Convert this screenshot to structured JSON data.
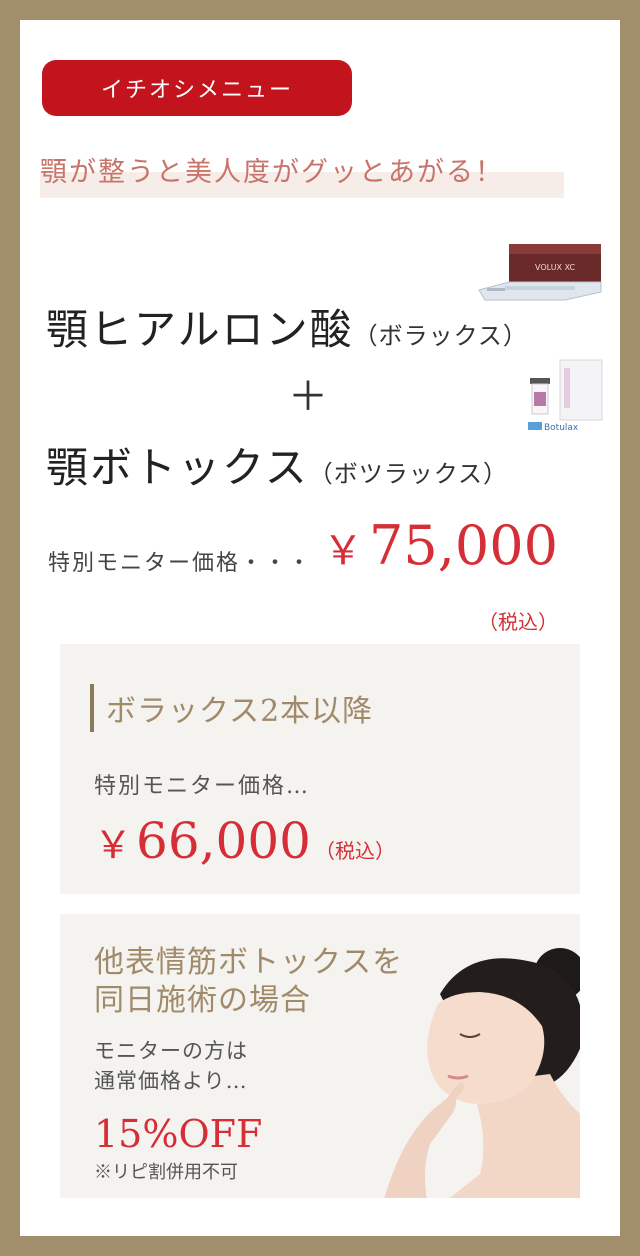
{
  "badge": "イチオシメニュー",
  "tagline": "顎が整うと美人度がグッとあがる！",
  "product1": {
    "name": "顎ヒアルロン酸",
    "note": "（ボラックス）"
  },
  "plus": "＋",
  "product2": {
    "name": "顎ボトックス",
    "note": "（ボツラックス）"
  },
  "monitor_label": "特別モニター価格・・・",
  "price": {
    "yen": "￥",
    "amount": "75,000",
    "tax": "（税込）"
  },
  "box1": {
    "title": "ボラックス2本以降",
    "label": "特別モニター価格…",
    "yen": "￥",
    "amount": "66,000",
    "tax": "（税込）"
  },
  "box2": {
    "heading_line1": "他表情筋ボトックスを",
    "heading_line2": "同日施術の場合",
    "sub_line1": "モニターの方は",
    "sub_line2": "通常価格より…",
    "discount": "15%OFF",
    "note": "※リピ割併用不可"
  },
  "product_image_text": {
    "volux": "VOLUX XC",
    "botulax": "Botulax"
  },
  "colors": {
    "frame": "#a08f6a",
    "accent_red": "#c3141e",
    "price_red": "#d52e36",
    "gold_text": "#a08a6a"
  }
}
